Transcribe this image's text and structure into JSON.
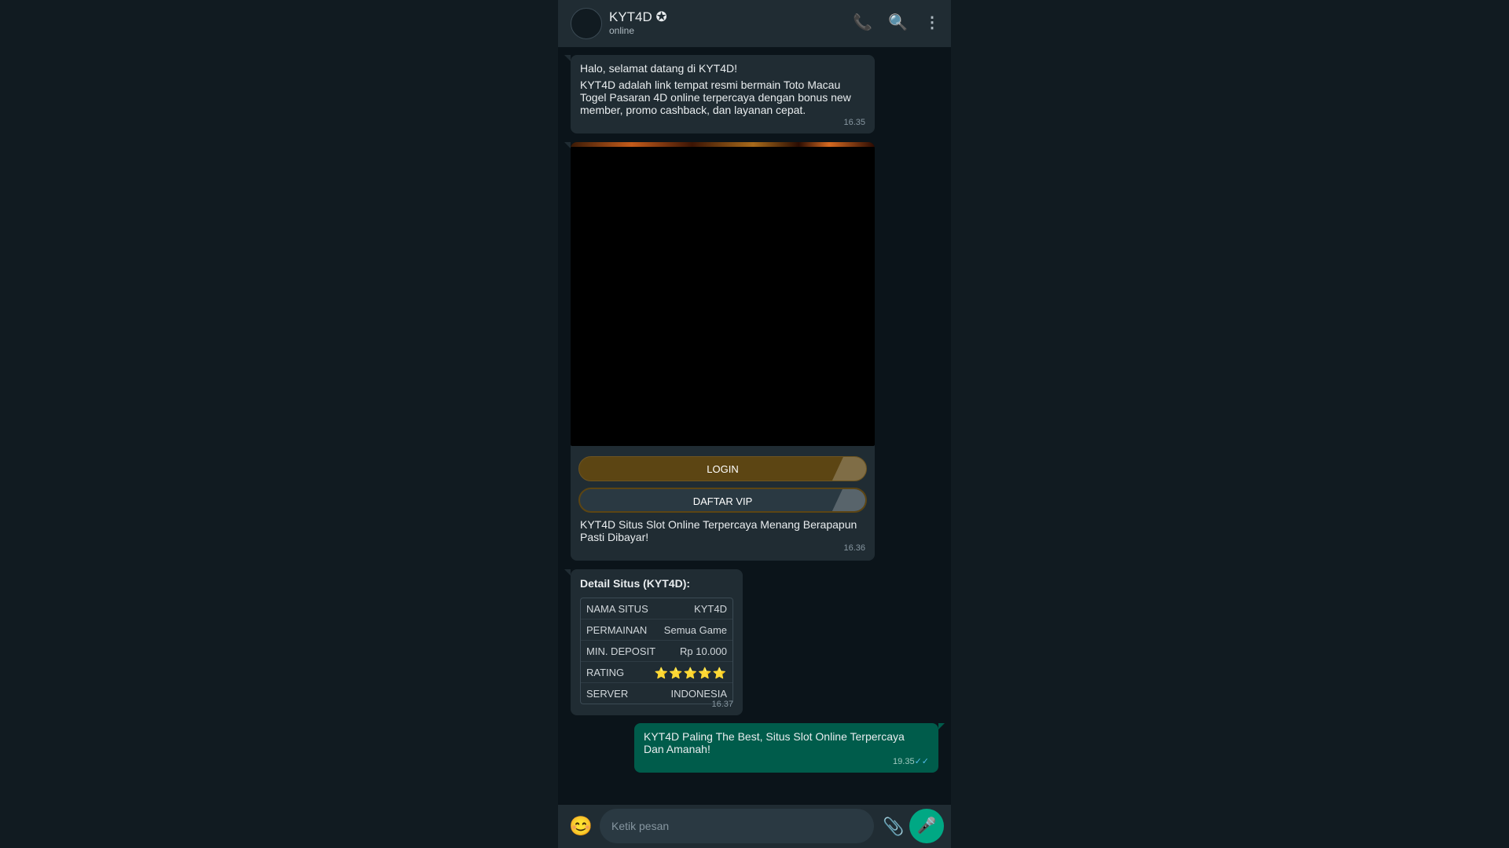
{
  "header": {
    "title": "KYT4D ✪",
    "status": "online"
  },
  "icons": {
    "phone": "phone-icon",
    "search": "search-icon",
    "menu": "more-vertical-icon",
    "emoji": "emoji-icon",
    "attach": "paperclip-icon",
    "mic": "microphone-icon"
  },
  "messages": {
    "m1": {
      "greeting": "Halo, selamat datang di KYT4D!",
      "body": "KYT4D adalah link tempat resmi bermain Toto Macau Togel Pasaran 4D online terpercaya dengan bonus new member, promo cashback, dan layanan cepat.",
      "time": "16.35"
    },
    "m2": {
      "login_label": "LOGIN",
      "register_label": "DAFTAR VIP",
      "caption": "KYT4D Situs Slot Online Terpercaya Menang Berapapun Pasti Dibayar!",
      "time": "16.36"
    },
    "m3": {
      "heading": "Detail Situs (KYT4D):",
      "rows": [
        {
          "key": "NAMA SITUS",
          "value": "KYT4D"
        },
        {
          "key": "PERMAINAN",
          "value": "Semua Game"
        },
        {
          "key": "MIN. DEPOSIT",
          "value": "Rp 10.000"
        },
        {
          "key": "RATING",
          "value": "⭐⭐⭐⭐⭐"
        },
        {
          "key": "SERVER",
          "value": "INDONESIA"
        }
      ],
      "time": "16.37"
    },
    "m4": {
      "text": "KYT4D Paling The Best, Situs Slot Online Terpercaya Dan Amanah!",
      "time": "19.35",
      "ticks": "✓✓"
    }
  },
  "composer": {
    "placeholder": "Ketik pesan"
  },
  "colors": {
    "background": "#0b141a",
    "panel": "#202c33",
    "incoming": "#202c33",
    "outgoing": "#005c4b",
    "accent": "#00a884",
    "login_pill": "#5c4513",
    "register_pill": "#2a3942"
  }
}
